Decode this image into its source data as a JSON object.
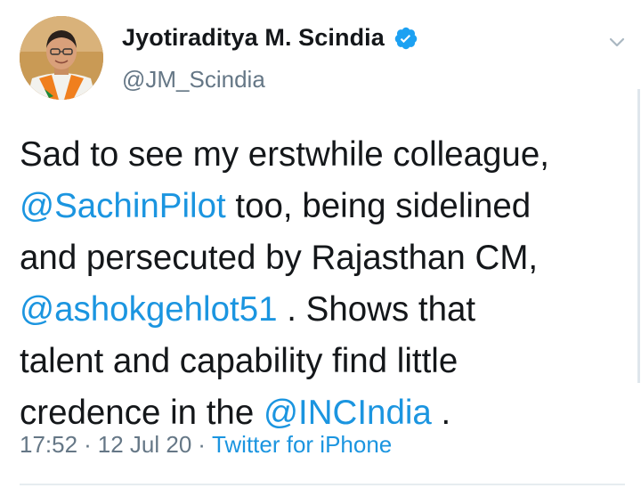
{
  "author": {
    "display_name": "Jyotiraditya M. Scindia",
    "handle": "@JM_Scindia",
    "verified": true,
    "verified_icon": "verified-badge-icon",
    "avatar_icon": "avatar-photo"
  },
  "tweet": {
    "segments": [
      {
        "text": "Sad to see my erstwhile colleague,\n",
        "type": "text"
      },
      {
        "text": "@SachinPilot",
        "type": "mention"
      },
      {
        "text": " too, being sidelined\nand persecuted by Rajasthan CM,\n",
        "type": "text"
      },
      {
        "text": "@ashokgehlot51",
        "type": "mention"
      },
      {
        "text": " . Shows that\ntalent and capability find little\ncredence in the ",
        "type": "text"
      },
      {
        "text": "@INCIndia",
        "type": "mention"
      },
      {
        "text": " .",
        "type": "text"
      }
    ]
  },
  "meta": {
    "time": "17:52",
    "separator": "·",
    "date": "12 Jul 20",
    "source": "Twitter for iPhone"
  },
  "menu": {
    "icon": "chevron-down-icon"
  },
  "colors": {
    "link": "#1b95e0",
    "secondary": "#657786",
    "text": "#14171a",
    "verified": "#1da1f2"
  }
}
